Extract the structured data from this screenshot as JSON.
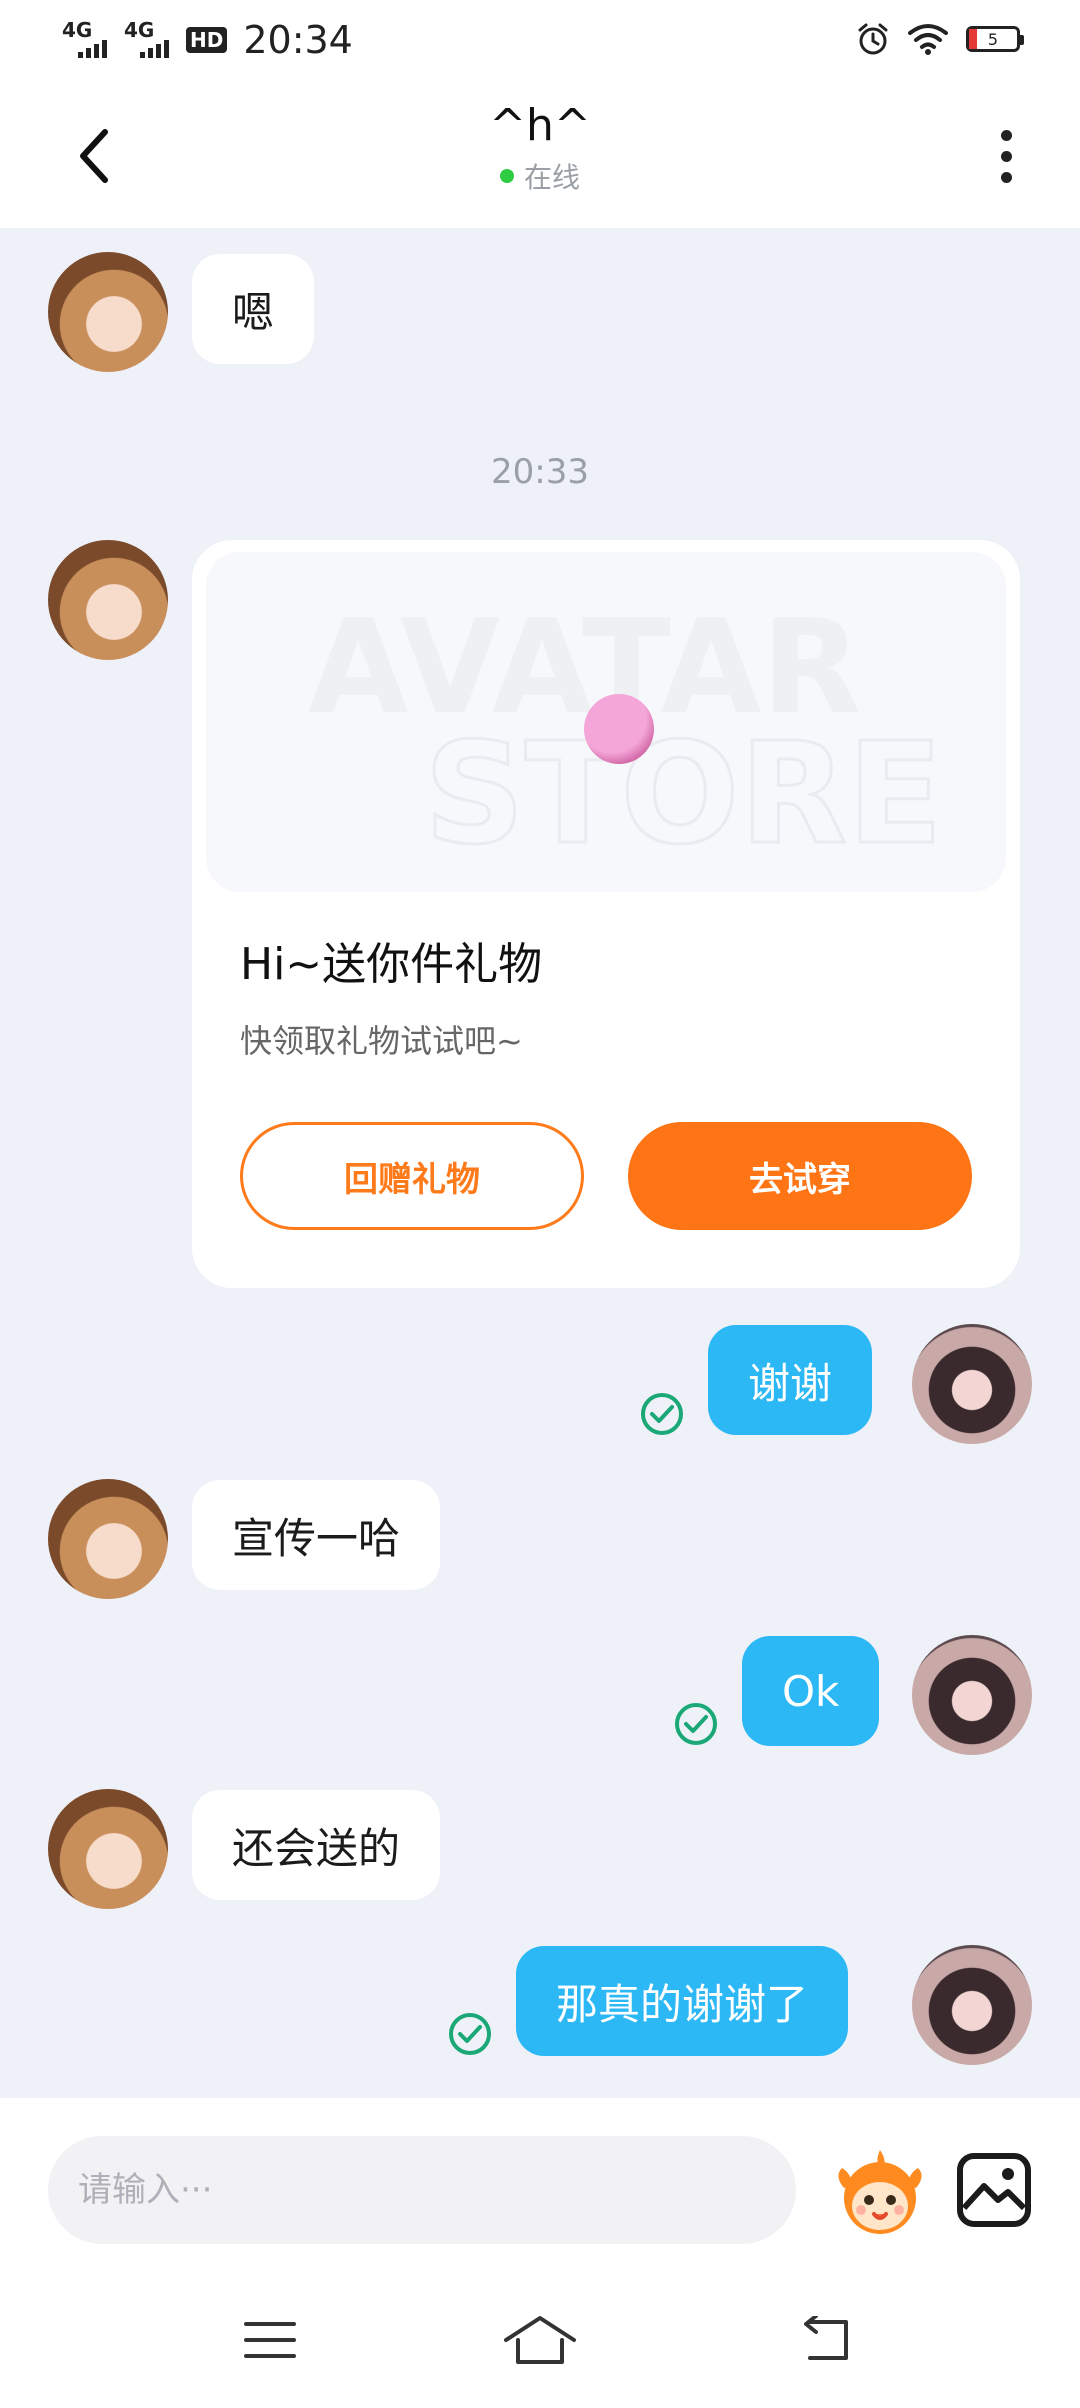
{
  "status_bar": {
    "signal_1": "4G",
    "signal_2": "4G",
    "hd_badge": "HD",
    "time": "20:34",
    "battery": "5"
  },
  "header": {
    "title": "^h^",
    "status": "在线"
  },
  "messages": [
    {
      "from": "peer",
      "text": "嗯"
    },
    {
      "type": "time",
      "text": "20:33"
    },
    {
      "from": "peer",
      "type": "gift_card",
      "title": "Hi~送你件礼物",
      "subtitle": "快领取礼物试试吧~",
      "button_return": "回赠礼物",
      "button_try": "去试穿"
    },
    {
      "from": "me",
      "text": "谢谢",
      "status": "sent"
    },
    {
      "from": "peer",
      "text": "宣传一哈"
    },
    {
      "from": "me",
      "text": "Ok",
      "status": "sent"
    },
    {
      "from": "peer",
      "text": "还会送的"
    },
    {
      "from": "me",
      "text": "那真的谢谢了",
      "status": "sent"
    }
  ],
  "input": {
    "placeholder": "请输入···"
  },
  "icons": {
    "back": "chevron-left-icon",
    "more": "more-vertical-icon",
    "emoji": "emoji-mascot-icon",
    "image": "image-icon",
    "menu": "menu-icon",
    "home": "home-icon",
    "return": "return-icon"
  },
  "colors": {
    "accent_blue": "#2cb7f5",
    "accent_orange": "#ff7414",
    "online_green": "#2ecc40",
    "check_green": "#1aa876",
    "background": "#eef1f8"
  }
}
